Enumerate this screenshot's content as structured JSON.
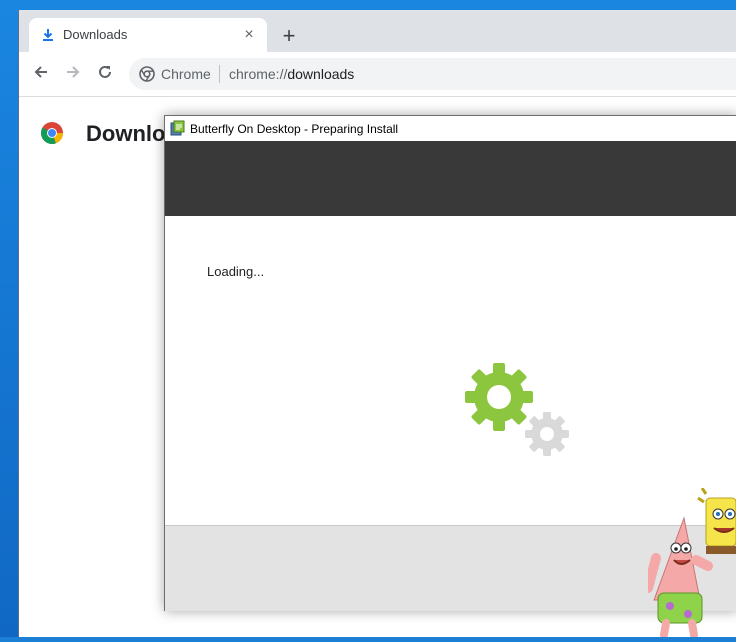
{
  "browser": {
    "tab": {
      "title": "Downloads",
      "close_glyph": "×"
    },
    "new_tab_glyph": "+",
    "omnibox": {
      "site_label": "Chrome",
      "url_scheme": "chrome://",
      "url_host": "downloads"
    },
    "page": {
      "title": "Downloads"
    }
  },
  "installer": {
    "window_title": "Butterfly On Desktop - Preparing Install",
    "status_text": "Loading...",
    "colors": {
      "header": "#393939",
      "gear_primary": "#8cc63f",
      "gear_secondary": "#d9d9d9",
      "footer": "#e3e3e3"
    }
  },
  "icons": {
    "tab": "download-icon",
    "back": "arrow-left-icon",
    "forward": "arrow-right-icon",
    "reload": "reload-icon",
    "omnibox": "chrome-icon",
    "page_logo": "chrome-logo-icon",
    "installer": "installer-app-icon",
    "loading": "gears-icon"
  }
}
